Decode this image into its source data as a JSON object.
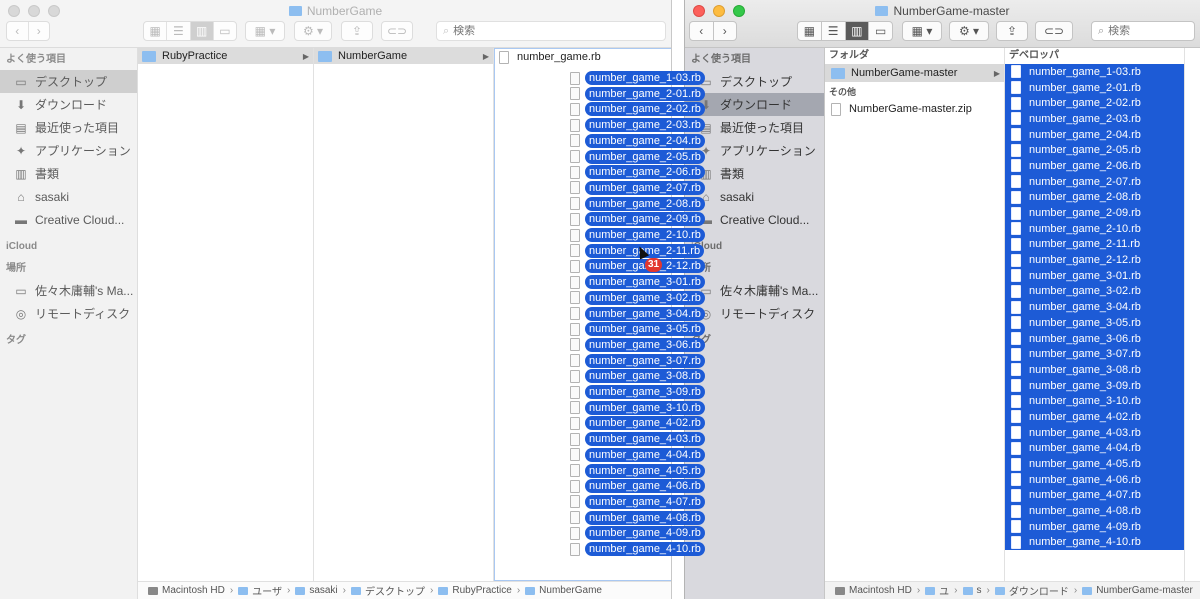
{
  "left_window": {
    "title": "NumberGame",
    "search_placeholder": "検索",
    "sidebar": {
      "favorites_header": "よく使う項目",
      "favorites": [
        {
          "label": "デスクトップ",
          "icon": "desktop-icon",
          "glyph": "▭",
          "selected": true
        },
        {
          "label": "ダウンロード",
          "icon": "download-icon",
          "glyph": "⬇",
          "selected": false
        },
        {
          "label": "最近使った項目",
          "icon": "recents-icon",
          "glyph": "▤",
          "selected": false
        },
        {
          "label": "アプリケーション",
          "icon": "applications-icon",
          "glyph": "✦",
          "selected": false
        },
        {
          "label": "書類",
          "icon": "documents-icon",
          "glyph": "▥",
          "selected": false
        },
        {
          "label": "sasaki",
          "icon": "home-icon",
          "glyph": "⌂",
          "selected": false
        },
        {
          "label": "Creative Cloud...",
          "icon": "folder-icon",
          "glyph": "▬",
          "selected": false
        }
      ],
      "icloud_header": "iCloud",
      "locations_header": "場所",
      "locations": [
        {
          "label": "佐々木庸輔's Ma...",
          "icon": "laptop-icon",
          "glyph": "▭"
        },
        {
          "label": "リモートディスク",
          "icon": "remote-disc-icon",
          "glyph": "◎"
        }
      ],
      "tags_header": "タグ"
    },
    "columns": {
      "col1": {
        "label": "RubyPractice"
      },
      "col2": {
        "label": "NumberGame"
      },
      "col3": {
        "label": "number_game.rb"
      }
    },
    "drag_count": "31",
    "pathbar": [
      "Macintosh HD",
      "ユーザ",
      "sasaki",
      "デスクトップ",
      "RubyPractice",
      "NumberGame"
    ]
  },
  "dragged_files": [
    "number_game_1-03.rb",
    "number_game_2-01.rb",
    "number_game_2-02.rb",
    "number_game_2-03.rb",
    "number_game_2-04.rb",
    "number_game_2-05.rb",
    "number_game_2-06.rb",
    "number_game_2-07.rb",
    "number_game_2-08.rb",
    "number_game_2-09.rb",
    "number_game_2-10.rb",
    "number_game_2-11.rb",
    "number_game_2-12.rb",
    "number_game_3-01.rb",
    "number_game_3-02.rb",
    "number_game_3-04.rb",
    "number_game_3-05.rb",
    "number_game_3-06.rb",
    "number_game_3-07.rb",
    "number_game_3-08.rb",
    "number_game_3-09.rb",
    "number_game_3-10.rb",
    "number_game_4-02.rb",
    "number_game_4-03.rb",
    "number_game_4-04.rb",
    "number_game_4-05.rb",
    "number_game_4-06.rb",
    "number_game_4-07.rb",
    "number_game_4-08.rb",
    "number_game_4-09.rb",
    "number_game_4-10.rb"
  ],
  "right_window": {
    "title": "NumberGame-master",
    "search_placeholder": "検索",
    "sidebar": {
      "favorites_header": "よく使う項目",
      "favorites": [
        {
          "label": "デスクトップ",
          "icon": "desktop-icon",
          "glyph": "▭",
          "selected": false
        },
        {
          "label": "ダウンロード",
          "icon": "download-icon",
          "glyph": "⬇",
          "selected": true
        },
        {
          "label": "最近使った項目",
          "icon": "recents-icon",
          "glyph": "▤",
          "selected": false
        },
        {
          "label": "アプリケーション",
          "icon": "applications-icon",
          "glyph": "✦",
          "selected": false
        },
        {
          "label": "書類",
          "icon": "documents-icon",
          "glyph": "▥",
          "selected": false
        },
        {
          "label": "sasaki",
          "icon": "home-icon",
          "glyph": "⌂",
          "selected": false
        },
        {
          "label": "Creative Cloud...",
          "icon": "folder-icon",
          "glyph": "▬",
          "selected": false
        }
      ],
      "icloud_header": "iCloud",
      "locations_header": "場所",
      "locations": [
        {
          "label": "佐々木庸輔's Ma...",
          "icon": "laptop-icon",
          "glyph": "▭"
        },
        {
          "label": "リモートディスク",
          "icon": "remote-disc-icon",
          "glyph": "◎"
        }
      ],
      "tags_header": "タグ"
    },
    "col1": {
      "header": "フォルダ",
      "folder": "NumberGame-master",
      "other_header": "その他",
      "zip": "NumberGame-master.zip"
    },
    "col2": {
      "header": "デベロッパ"
    },
    "pathbar": [
      "Macintosh HD",
      "ユ",
      "s",
      "ダウンロード",
      "NumberGame-master"
    ]
  },
  "colors": {
    "selection_blue": "#1d5bd6",
    "folder_blue": "#8dbef0",
    "badge_red": "#e2372f"
  }
}
